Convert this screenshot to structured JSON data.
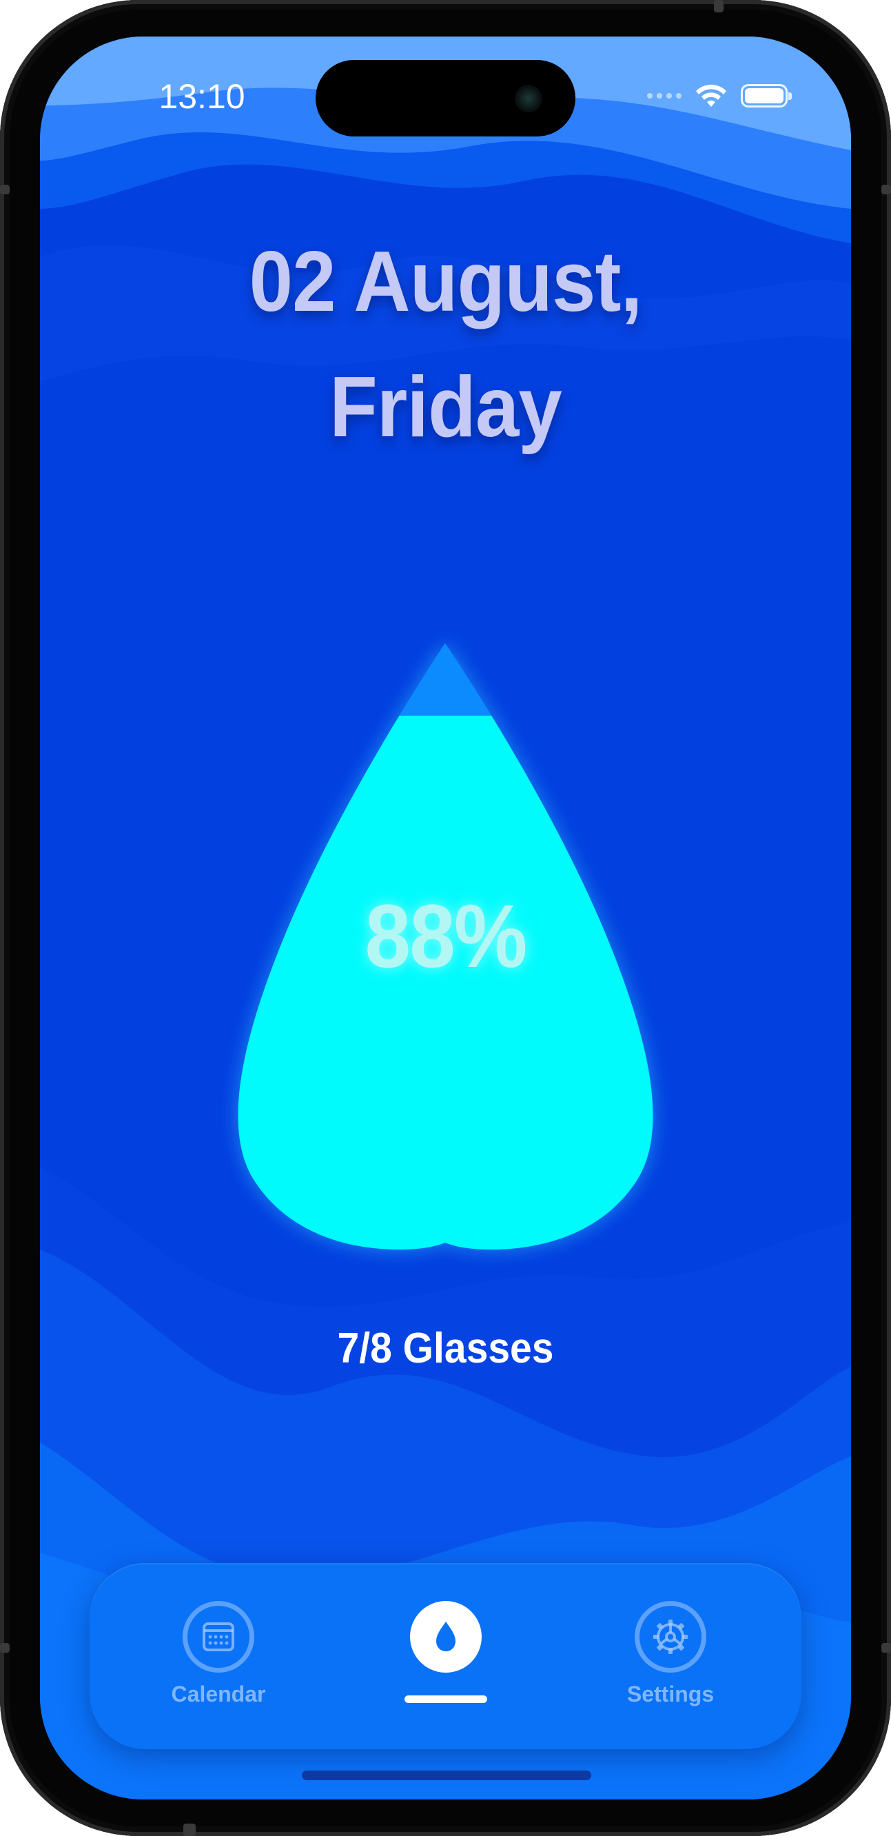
{
  "status_bar": {
    "time": "13:10"
  },
  "header": {
    "date_line1": "02 August,",
    "date_line2": "Friday"
  },
  "progress": {
    "percent_label": "88%",
    "fill_fraction": 0.88,
    "glasses_label": "7/8 Glasses"
  },
  "tab_bar": {
    "tabs": [
      {
        "label": "Calendar",
        "icon": "calendar-icon",
        "active": false
      },
      {
        "label": "",
        "icon": "water-drop-icon",
        "active": true
      },
      {
        "label": "Settings",
        "icon": "gear-icon",
        "active": false
      }
    ]
  },
  "colors": {
    "background": "#0340e0",
    "drop_fill": "#00fbfd",
    "drop_empty": "#0b8bff",
    "tab_bar": "#0a72f6",
    "date_text": "#c4c9f5"
  }
}
